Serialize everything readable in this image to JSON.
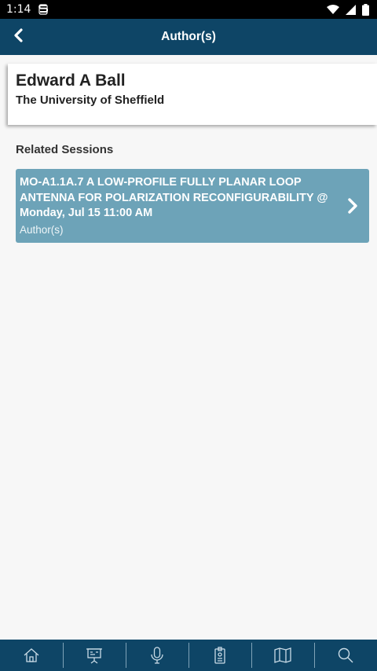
{
  "status_bar": {
    "time": "1:14",
    "icons": [
      "s-app-icon",
      "wifi-icon",
      "signal-icon",
      "battery-icon"
    ]
  },
  "header": {
    "title": "Author(s)",
    "back_icon": "chevron-left-icon"
  },
  "author": {
    "name": "Edward A Ball",
    "affiliation": "The University of Sheffield"
  },
  "related_sessions": {
    "heading": "Related Sessions",
    "items": [
      {
        "title": "MO-A1.1A.7 A LOW-PROFILE FULLY PLANAR LOOP ANTENNA FOR POLARIZATION RECONFIGURABILITY @ Monday, Jul 15 11:00 AM",
        "role": "Author(s)",
        "icon": "chevron-right-icon"
      }
    ]
  },
  "bottom_nav": {
    "items": [
      "home-icon",
      "presentation-icon",
      "microphone-icon",
      "badge-icon",
      "map-icon",
      "search-icon"
    ]
  },
  "colors": {
    "header_bg": "#0e4566",
    "session_card_bg": "#6da3b8",
    "page_bg": "#f7f7f7"
  }
}
